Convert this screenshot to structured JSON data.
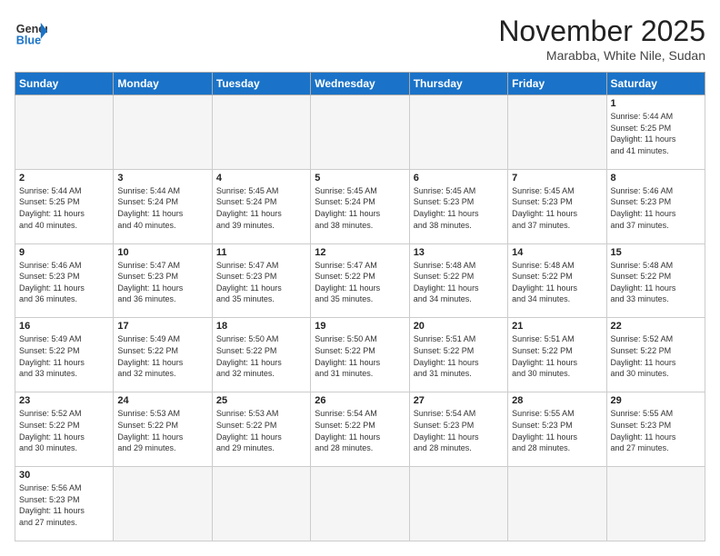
{
  "header": {
    "logo_general": "General",
    "logo_blue": "Blue",
    "month_title": "November 2025",
    "subtitle": "Marabba, White Nile, Sudan"
  },
  "weekdays": [
    "Sunday",
    "Monday",
    "Tuesday",
    "Wednesday",
    "Thursday",
    "Friday",
    "Saturday"
  ],
  "weeks": [
    [
      {
        "num": "",
        "info": ""
      },
      {
        "num": "",
        "info": ""
      },
      {
        "num": "",
        "info": ""
      },
      {
        "num": "",
        "info": ""
      },
      {
        "num": "",
        "info": ""
      },
      {
        "num": "",
        "info": ""
      },
      {
        "num": "1",
        "info": "Sunrise: 5:44 AM\nSunset: 5:25 PM\nDaylight: 11 hours\nand 41 minutes."
      }
    ],
    [
      {
        "num": "2",
        "info": "Sunrise: 5:44 AM\nSunset: 5:25 PM\nDaylight: 11 hours\nand 40 minutes."
      },
      {
        "num": "3",
        "info": "Sunrise: 5:44 AM\nSunset: 5:24 PM\nDaylight: 11 hours\nand 40 minutes."
      },
      {
        "num": "4",
        "info": "Sunrise: 5:45 AM\nSunset: 5:24 PM\nDaylight: 11 hours\nand 39 minutes."
      },
      {
        "num": "5",
        "info": "Sunrise: 5:45 AM\nSunset: 5:24 PM\nDaylight: 11 hours\nand 38 minutes."
      },
      {
        "num": "6",
        "info": "Sunrise: 5:45 AM\nSunset: 5:23 PM\nDaylight: 11 hours\nand 38 minutes."
      },
      {
        "num": "7",
        "info": "Sunrise: 5:45 AM\nSunset: 5:23 PM\nDaylight: 11 hours\nand 37 minutes."
      },
      {
        "num": "8",
        "info": "Sunrise: 5:46 AM\nSunset: 5:23 PM\nDaylight: 11 hours\nand 37 minutes."
      }
    ],
    [
      {
        "num": "9",
        "info": "Sunrise: 5:46 AM\nSunset: 5:23 PM\nDaylight: 11 hours\nand 36 minutes."
      },
      {
        "num": "10",
        "info": "Sunrise: 5:47 AM\nSunset: 5:23 PM\nDaylight: 11 hours\nand 36 minutes."
      },
      {
        "num": "11",
        "info": "Sunrise: 5:47 AM\nSunset: 5:23 PM\nDaylight: 11 hours\nand 35 minutes."
      },
      {
        "num": "12",
        "info": "Sunrise: 5:47 AM\nSunset: 5:22 PM\nDaylight: 11 hours\nand 35 minutes."
      },
      {
        "num": "13",
        "info": "Sunrise: 5:48 AM\nSunset: 5:22 PM\nDaylight: 11 hours\nand 34 minutes."
      },
      {
        "num": "14",
        "info": "Sunrise: 5:48 AM\nSunset: 5:22 PM\nDaylight: 11 hours\nand 34 minutes."
      },
      {
        "num": "15",
        "info": "Sunrise: 5:48 AM\nSunset: 5:22 PM\nDaylight: 11 hours\nand 33 minutes."
      }
    ],
    [
      {
        "num": "16",
        "info": "Sunrise: 5:49 AM\nSunset: 5:22 PM\nDaylight: 11 hours\nand 33 minutes."
      },
      {
        "num": "17",
        "info": "Sunrise: 5:49 AM\nSunset: 5:22 PM\nDaylight: 11 hours\nand 32 minutes."
      },
      {
        "num": "18",
        "info": "Sunrise: 5:50 AM\nSunset: 5:22 PM\nDaylight: 11 hours\nand 32 minutes."
      },
      {
        "num": "19",
        "info": "Sunrise: 5:50 AM\nSunset: 5:22 PM\nDaylight: 11 hours\nand 31 minutes."
      },
      {
        "num": "20",
        "info": "Sunrise: 5:51 AM\nSunset: 5:22 PM\nDaylight: 11 hours\nand 31 minutes."
      },
      {
        "num": "21",
        "info": "Sunrise: 5:51 AM\nSunset: 5:22 PM\nDaylight: 11 hours\nand 30 minutes."
      },
      {
        "num": "22",
        "info": "Sunrise: 5:52 AM\nSunset: 5:22 PM\nDaylight: 11 hours\nand 30 minutes."
      }
    ],
    [
      {
        "num": "23",
        "info": "Sunrise: 5:52 AM\nSunset: 5:22 PM\nDaylight: 11 hours\nand 30 minutes."
      },
      {
        "num": "24",
        "info": "Sunrise: 5:53 AM\nSunset: 5:22 PM\nDaylight: 11 hours\nand 29 minutes."
      },
      {
        "num": "25",
        "info": "Sunrise: 5:53 AM\nSunset: 5:22 PM\nDaylight: 11 hours\nand 29 minutes."
      },
      {
        "num": "26",
        "info": "Sunrise: 5:54 AM\nSunset: 5:22 PM\nDaylight: 11 hours\nand 28 minutes."
      },
      {
        "num": "27",
        "info": "Sunrise: 5:54 AM\nSunset: 5:23 PM\nDaylight: 11 hours\nand 28 minutes."
      },
      {
        "num": "28",
        "info": "Sunrise: 5:55 AM\nSunset: 5:23 PM\nDaylight: 11 hours\nand 28 minutes."
      },
      {
        "num": "29",
        "info": "Sunrise: 5:55 AM\nSunset: 5:23 PM\nDaylight: 11 hours\nand 27 minutes."
      }
    ],
    [
      {
        "num": "30",
        "info": "Sunrise: 5:56 AM\nSunset: 5:23 PM\nDaylight: 11 hours\nand 27 minutes."
      },
      {
        "num": "",
        "info": ""
      },
      {
        "num": "",
        "info": ""
      },
      {
        "num": "",
        "info": ""
      },
      {
        "num": "",
        "info": ""
      },
      {
        "num": "",
        "info": ""
      },
      {
        "num": "",
        "info": ""
      }
    ]
  ]
}
